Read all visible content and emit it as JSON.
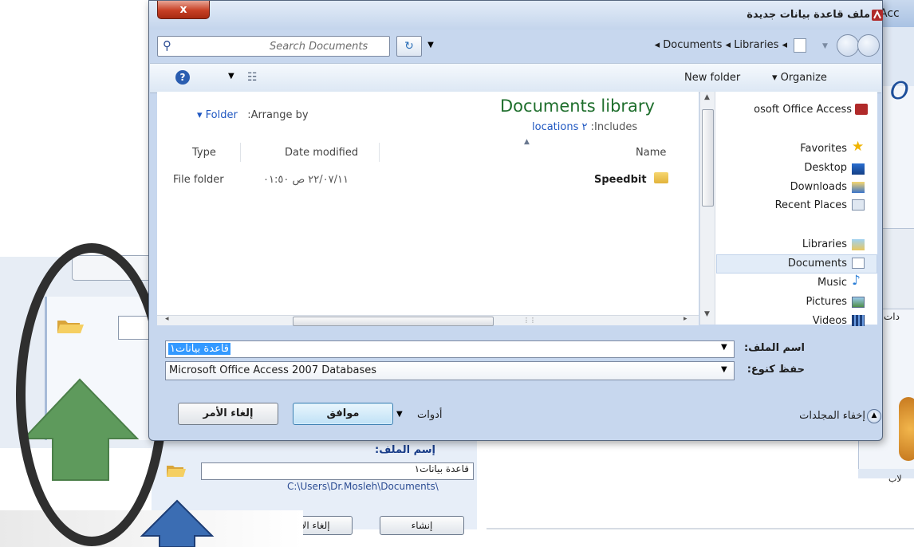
{
  "background_window": {
    "title_fragment": "Acc",
    "office_text": "O",
    "label_1": "دات",
    "label_2": "لاب"
  },
  "background_pane": {
    "file_name_caption": "إسم الملف:",
    "file_name_value": "قاعدة بيانات١",
    "path": "C:\\Users\\Dr.Mosleh\\Documents\\",
    "create_button": "إنشاء",
    "cancel_button": "إلغاء الأمر"
  },
  "dialog": {
    "title": "ملف قاعدة بيانات جديدة",
    "close_glyph": "x",
    "search_placeholder": "Search Documents",
    "breadcrumb": "◂ Documents ◂ Libraries ◂",
    "toolbar": {
      "new_folder": "New folder",
      "organize": "▾ Organize",
      "help_glyph": "?"
    },
    "library": {
      "title": "Documents library",
      "includes_label": ":Includes",
      "includes_link": "locations ٢",
      "arrange_label": ":Arrange by",
      "arrange_link": "▾ Folder"
    },
    "columns": {
      "name": "Name",
      "date_modified": "Date modified",
      "type": "Type"
    },
    "rows": [
      {
        "name": "Speedbit",
        "date": "٢٢/٠٧/١١ ص ٠١:٥٠",
        "type": "File folder"
      }
    ],
    "nav": {
      "root": "osoft Office Access",
      "favorites": "Favorites",
      "desktop": "Desktop",
      "downloads": "Downloads",
      "recent_places": "Recent Places",
      "libraries": "Libraries",
      "documents": "Documents",
      "music": "Music",
      "pictures": "Pictures",
      "videos": "Videos"
    },
    "file_name_label": "اسم الملف:",
    "file_name_value": "قاعدة بيانات١",
    "save_type_label": "حفظ كنوع:",
    "save_type_value": "Microsoft Office Access 2007 Databases",
    "hide_folders": "إخفاء المجلدات",
    "tools": "أدوات",
    "ok_button": "موافق",
    "cancel_button": "إلغاء الأمر"
  },
  "colors": {
    "arrow_green": "#5e9a5c",
    "arrow_blue": "#3b6db3",
    "annotation_oval": "#2f2f2f",
    "library_title": "#1e6e2c",
    "link_blue": "#1f57c1"
  },
  "icons": [
    "search-icon",
    "refresh-icon",
    "help-icon",
    "folder-icon",
    "star-icon",
    "desktop-icon",
    "download-icon",
    "recent-places-icon",
    "library-icon",
    "document-icon",
    "music-icon",
    "picture-icon",
    "video-icon",
    "access-icon",
    "close-icon"
  ]
}
